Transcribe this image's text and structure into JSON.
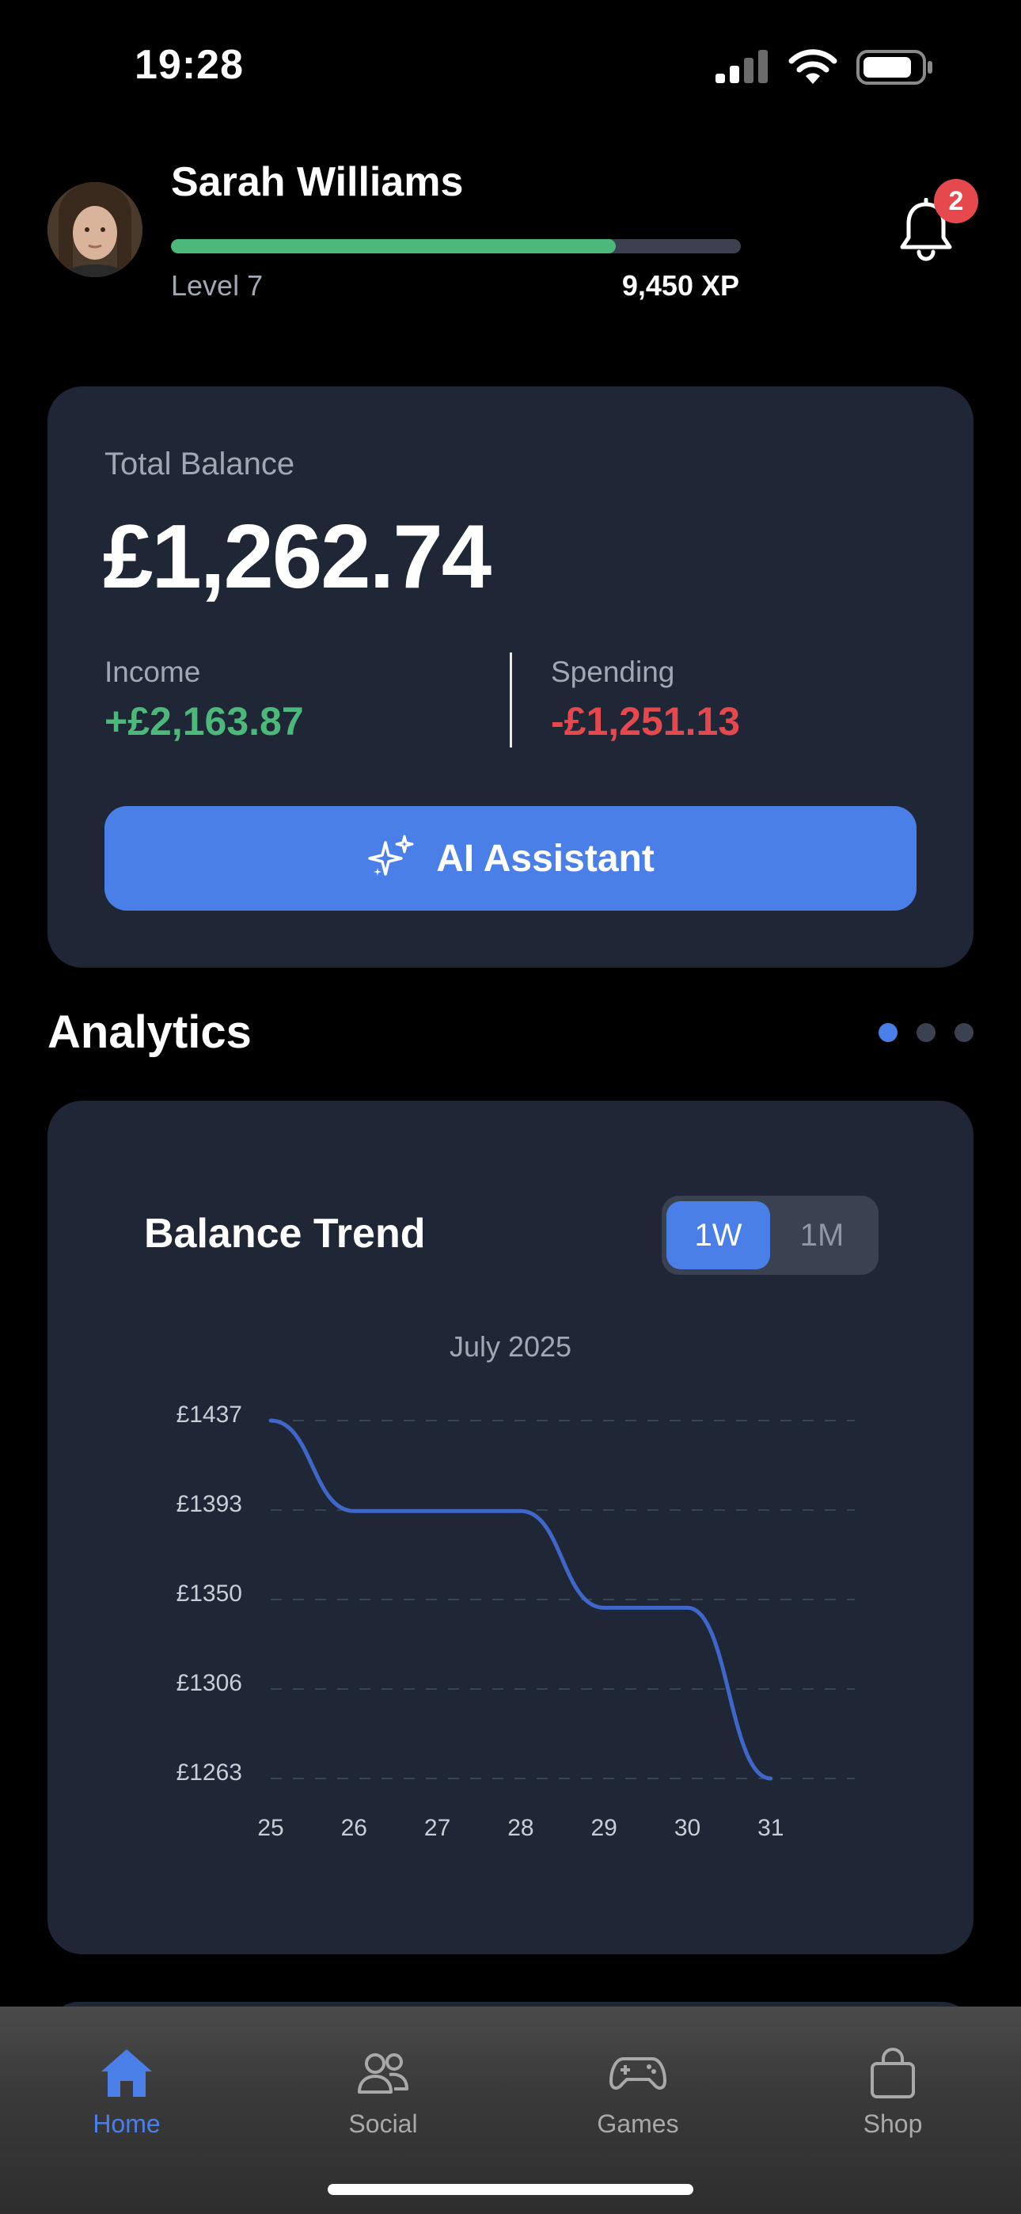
{
  "status": {
    "time": "19:28"
  },
  "profile": {
    "name": "Sarah Williams",
    "level": "Level 7",
    "xp": "9,450 XP",
    "level_progress": 0.78,
    "notifications": "2"
  },
  "balance": {
    "label": "Total Balance",
    "amount": "£1,262.74",
    "income_label": "Income",
    "income_value": "+£2,163.87",
    "spending_label": "Spending",
    "spending_value": "-£1,251.13",
    "ai_button": "AI Assistant"
  },
  "analytics": {
    "title": "Analytics",
    "chart_title": "Balance Trend",
    "range_options": [
      "1W",
      "1M"
    ],
    "selected_range": "1W",
    "month_label": "July 2025"
  },
  "chart_data": {
    "type": "line",
    "title": "Balance Trend",
    "subtitle": "July 2025",
    "x": [
      "25",
      "26",
      "27",
      "28",
      "29",
      "30",
      "31"
    ],
    "series": [
      {
        "values": [
          1437,
          1393,
          1393,
          1393,
          1346,
          1346,
          1263
        ]
      }
    ],
    "y_ticks": [
      "£1437",
      "£1393",
      "£1350",
      "£1306",
      "£1263"
    ],
    "ylim": [
      1263,
      1437
    ],
    "grid": "dashed-horizontal",
    "line_color": "#3f66c9"
  },
  "tabs": [
    {
      "label": "Home",
      "icon": "home-icon",
      "active": true
    },
    {
      "label": "Social",
      "icon": "people-icon",
      "active": false
    },
    {
      "label": "Games",
      "icon": "gamepad-icon",
      "active": false
    },
    {
      "label": "Shop",
      "icon": "bag-icon",
      "active": false
    }
  ],
  "colors": {
    "accent": "#4b7fe8",
    "income": "#4cb87a",
    "spending": "#e5484d",
    "card": "#1f2736"
  }
}
